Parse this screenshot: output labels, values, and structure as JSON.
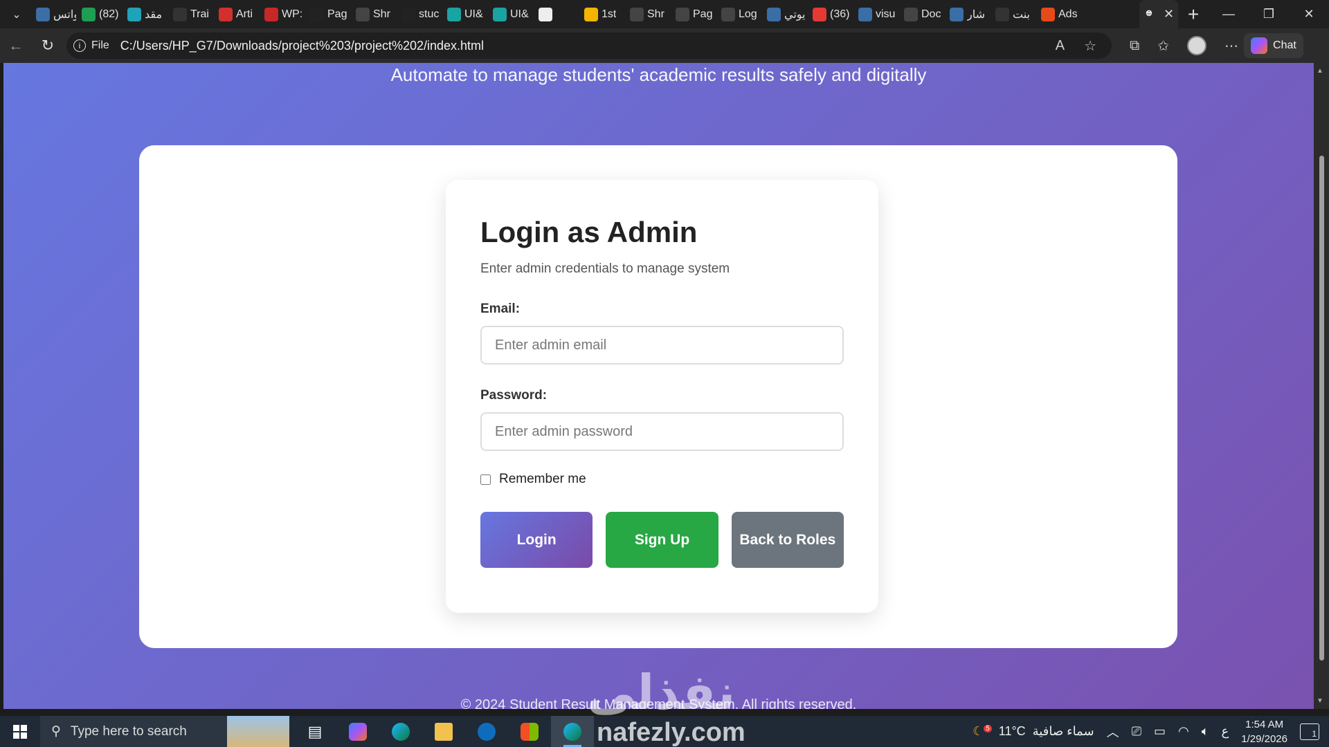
{
  "browser": {
    "tabs": [
      {
        "label": "واتس",
        "icon": "search-icon",
        "color": "#3a6ea5"
      },
      {
        "label": "(82)",
        "icon": "badge-icon",
        "color": "#1e9e52"
      },
      {
        "label": "مقد",
        "icon": "y-logo-icon",
        "color": "#1fa3b8"
      },
      {
        "label": "Trai",
        "icon": "dark-logo-icon",
        "color": "#333333"
      },
      {
        "label": "Arti",
        "icon": "pdf-icon",
        "color": "#d32f2f"
      },
      {
        "label": "WP:",
        "icon": "w-logo-icon",
        "color": "#c62828"
      },
      {
        "label": "Pag",
        "icon": "github-icon",
        "color": "#222222"
      },
      {
        "label": "Shr",
        "icon": "globe-icon",
        "color": "#444444"
      },
      {
        "label": "stuc",
        "icon": "github-icon",
        "color": "#222222"
      },
      {
        "label": "UI&",
        "icon": "ui-logo-icon",
        "color": "#1aa3a3"
      },
      {
        "label": "UI&",
        "icon": "ui-logo-icon",
        "color": "#1aa3a3"
      },
      {
        "label": "",
        "icon": "cursor-icon",
        "color": "#eeeeee"
      },
      {
        "label": "1st",
        "icon": "drive-icon",
        "color": "#f4b400"
      },
      {
        "label": "Shr",
        "icon": "globe-icon",
        "color": "#444444"
      },
      {
        "label": "Pag",
        "icon": "globe-icon",
        "color": "#444444"
      },
      {
        "label": "Log",
        "icon": "globe-icon",
        "color": "#444444"
      },
      {
        "label": "يوتي",
        "icon": "search-icon",
        "color": "#3a6ea5"
      },
      {
        "label": "(36)",
        "icon": "youtube-icon",
        "color": "#e53935"
      },
      {
        "label": "visu",
        "icon": "search-icon",
        "color": "#3a6ea5"
      },
      {
        "label": "Doc",
        "icon": "globe-icon",
        "color": "#444444"
      },
      {
        "label": "شار",
        "icon": "search-icon",
        "color": "#3a6ea5"
      },
      {
        "label": "بنت",
        "icon": "openai-icon",
        "color": "#333333"
      },
      {
        "label": "Ads",
        "icon": "a-logo-icon",
        "color": "#e64a19"
      }
    ],
    "active_tab_icon": "globe-icon",
    "address_scheme": "File",
    "address_url": "C:/Users/HP_G7/Downloads/project%203/project%202/index.html",
    "chat_label": "Chat"
  },
  "page": {
    "tagline": "Automate to manage students' academic results safely and digitally",
    "login": {
      "title": "Login as Admin",
      "subtitle": "Enter admin credentials to manage system",
      "email_label": "Email:",
      "email_placeholder": "Enter admin email",
      "email_value": "",
      "password_label": "Password:",
      "password_placeholder": "Enter admin password",
      "password_value": "",
      "remember_label": "Remember me",
      "remember_checked": false,
      "login_button": "Login",
      "signup_button": "Sign Up",
      "back_button": "Back to Roles"
    },
    "footer": "© 2024 Student Result Management System. All rights reserved.",
    "colors": {
      "gradient_start": "#6677e0",
      "gradient_end": "#7a52b0",
      "signup_green": "#28a745",
      "back_gray": "#6c757d"
    }
  },
  "watermark": {
    "arabic": "نفذلي",
    "latin": "nafezly.com"
  },
  "taskbar": {
    "search_placeholder": "Type here to search",
    "weather_badge": "5",
    "temperature": "11°C",
    "weather_desc": "سماء صافية",
    "input_lang": "ع",
    "time": "1:54 AM",
    "date": "1/29/2026",
    "notification_count": "1"
  }
}
